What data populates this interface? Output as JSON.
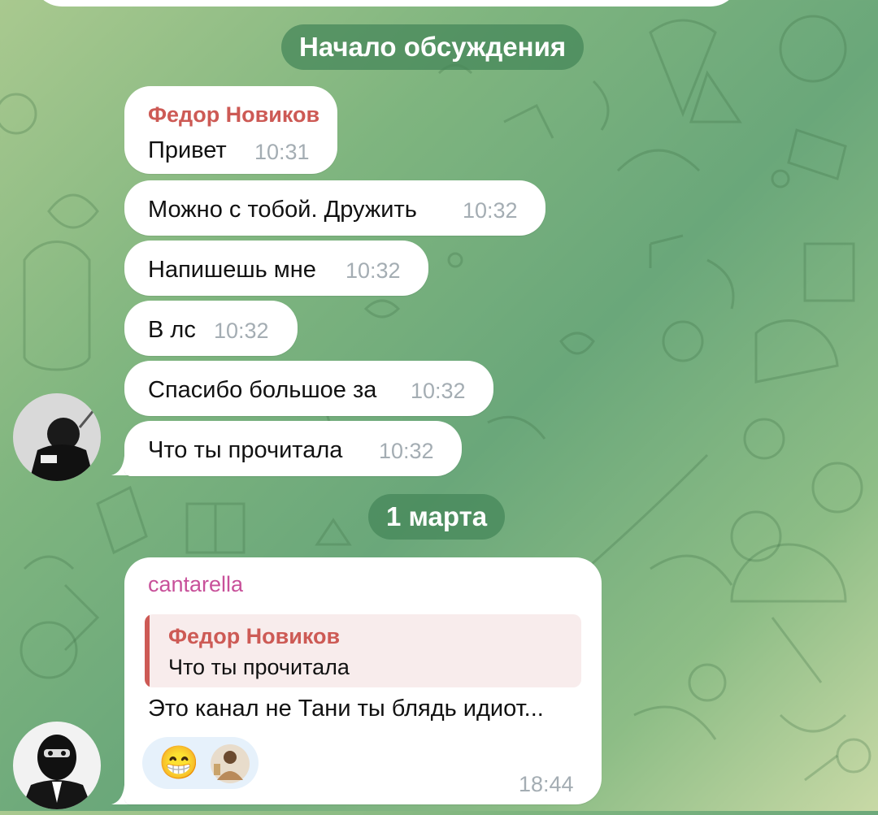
{
  "service": {
    "discussion_start": "Начало обсуждения",
    "date_divider": "1 марта"
  },
  "messages": [
    {
      "sender": "Федор Новиков",
      "text": "Привет",
      "time": "10:31"
    },
    {
      "text": "Можно с тобой. Дружить",
      "time": "10:32"
    },
    {
      "text": "Напишешь мне",
      "time": "10:32"
    },
    {
      "text": "В лс",
      "time": "10:32"
    },
    {
      "text": "Спасибо большое за",
      "time": "10:32"
    },
    {
      "text": "Что ты прочитала",
      "time": "10:32"
    }
  ],
  "reply_message": {
    "sender": "cantarella",
    "quote_sender": "Федор Новиков",
    "quote_text": "Что ты прочитала",
    "text": "Это канал не Тани ты блядь идиот...",
    "time": "18:44",
    "reaction_emoji": "😁"
  },
  "colors": {
    "sender_red": "#cd5a55",
    "sender_pink": "#c8519a",
    "time_gray": "#a4adb3",
    "pill_bg": "#46875a"
  }
}
